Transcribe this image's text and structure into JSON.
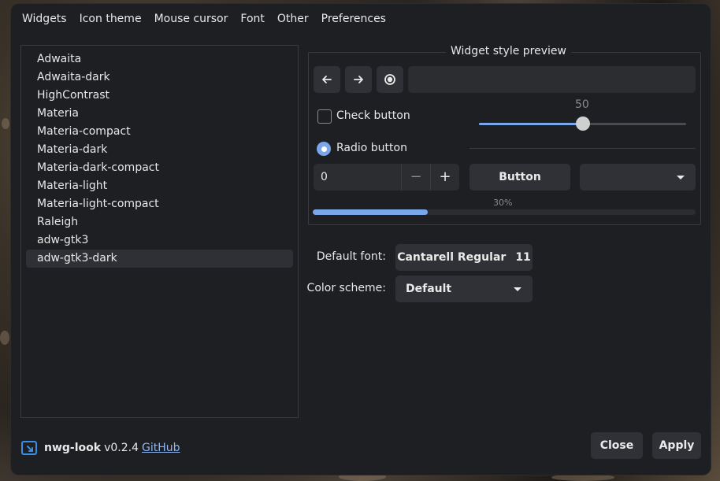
{
  "tabs": [
    "Widgets",
    "Icon theme",
    "Mouse cursor",
    "Font",
    "Other",
    "Preferences"
  ],
  "themes": {
    "items": [
      "Adwaita",
      "Adwaita-dark",
      "HighContrast",
      "Materia",
      "Materia-compact",
      "Materia-dark",
      "Materia-dark-compact",
      "Materia-light",
      "Materia-light-compact",
      "Raleigh",
      "adw-gtk3",
      "adw-gtk3-dark"
    ],
    "selected": "adw-gtk3-dark"
  },
  "preview": {
    "title": "Widget style preview",
    "back_icon": "arrow-left-icon",
    "forward_icon": "arrow-right-icon",
    "record_icon": "record-icon",
    "entry_value": "",
    "check_label": "Check button",
    "check_checked": false,
    "radio_label": "Radio button",
    "radio_checked": true,
    "slider_value": "50",
    "slider_fraction": 0.5,
    "spin_value": "0",
    "spin_minus": "−",
    "spin_plus": "+",
    "button_label": "Button",
    "combo_value": "",
    "progress_text": "30%",
    "progress_fraction": 0.3
  },
  "settings": {
    "font_label": "Default font:",
    "font_name": "Cantarell Regular",
    "font_size": "11",
    "scheme_label": "Color scheme:",
    "scheme_value": "Default"
  },
  "footer": {
    "app_name": "nwg-look",
    "version": "v0.2.4",
    "link": "GitHub",
    "close": "Close",
    "apply": "Apply"
  },
  "colors": {
    "accent": "#7aa7ea",
    "window_bg": "#1e1f22",
    "button_bg": "#303136"
  }
}
